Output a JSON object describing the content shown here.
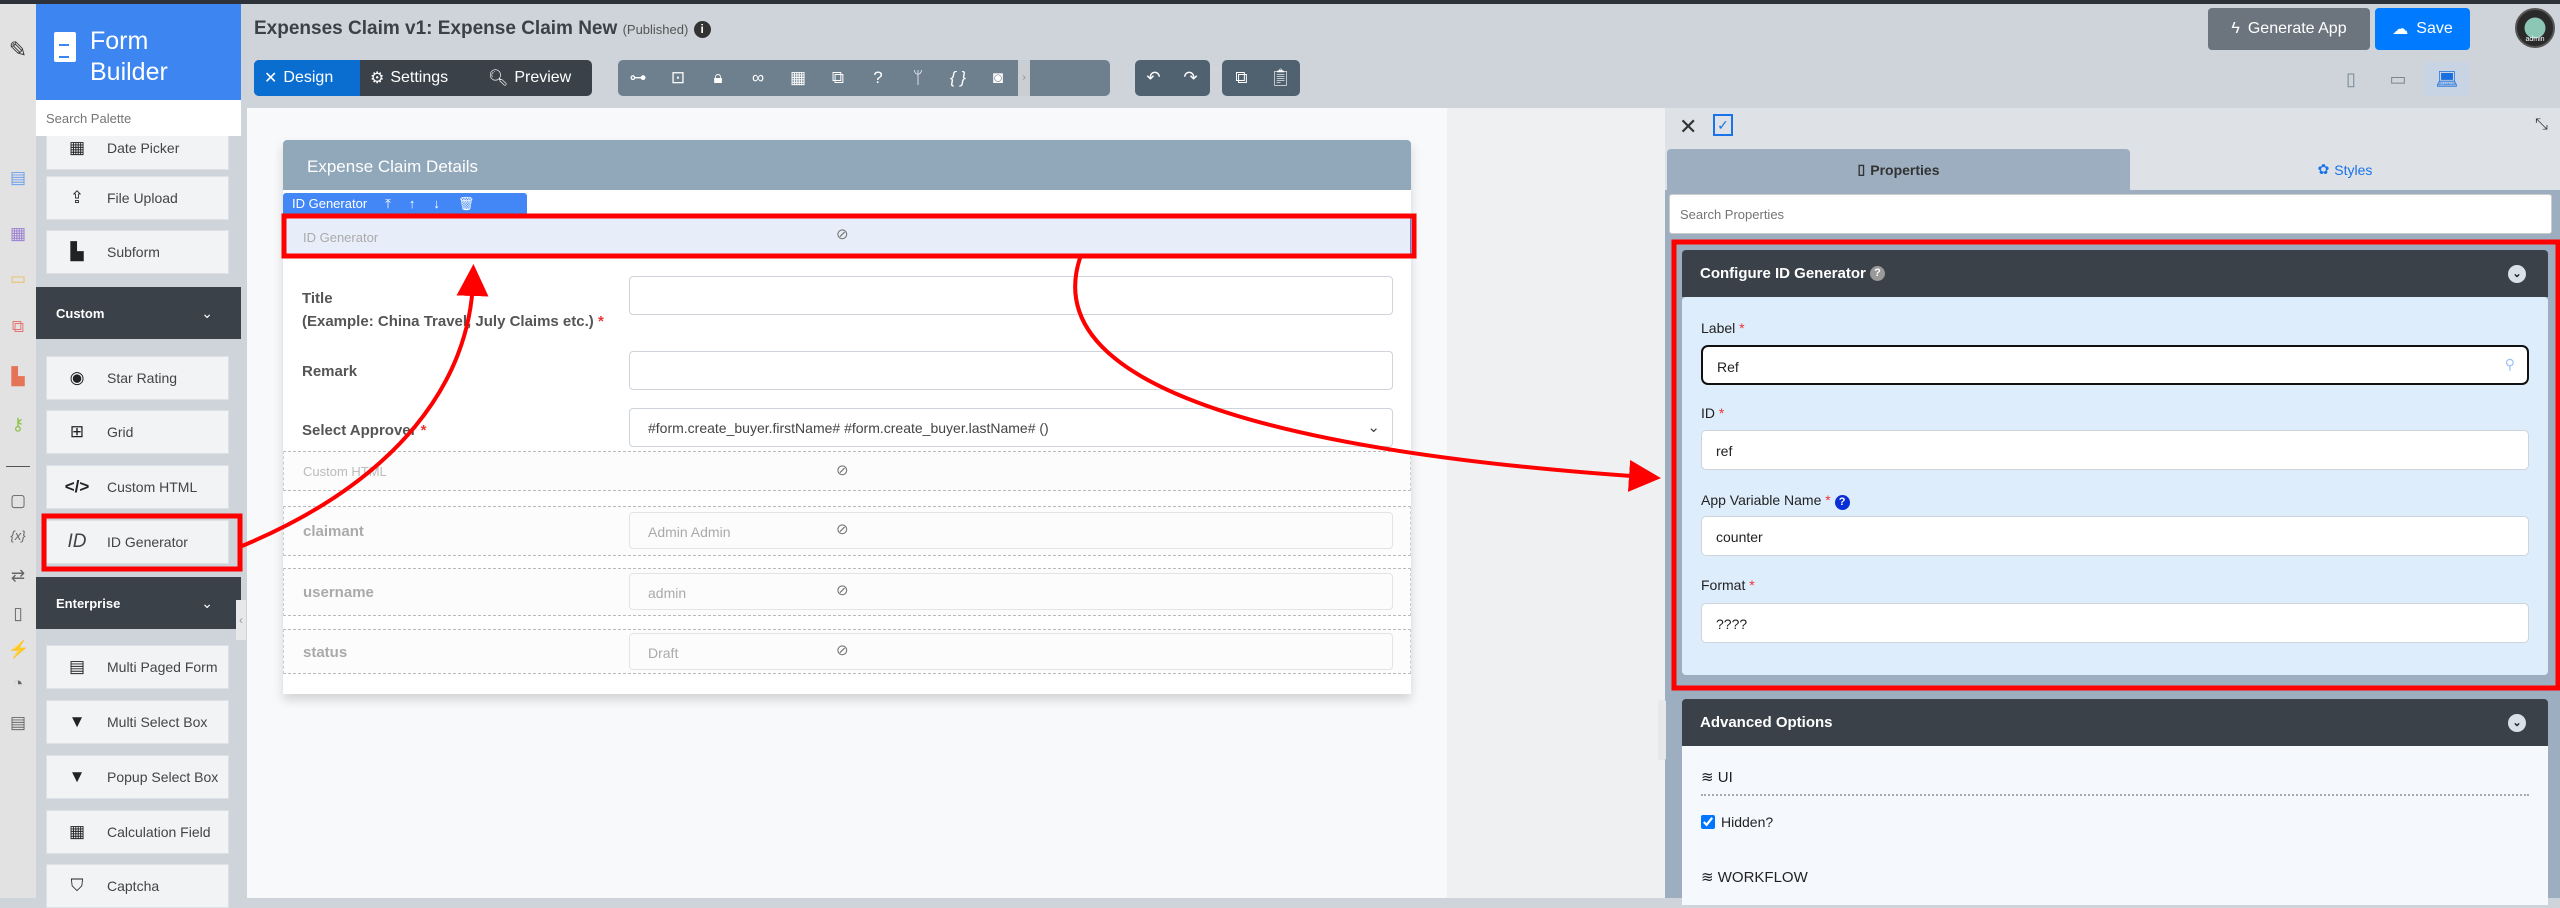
{
  "header": {
    "title": "Expenses Claim v1: Expense Claim New",
    "status": "(Published)",
    "generate_label": "Generate App",
    "save_label": "Save",
    "avatar_text": "admin"
  },
  "modes": [
    {
      "label": "Design",
      "icon": "design-icon"
    },
    {
      "label": "Settings",
      "icon": "gear-icon"
    },
    {
      "label": "Preview",
      "icon": "preview-icon"
    }
  ],
  "toolbar_icons": [
    "sitemap-icon",
    "import-icon",
    "lock-icon",
    "binoculars-icon",
    "table-icon",
    "translate-icon",
    "help-icon",
    "branch-icon",
    "braces-icon",
    "camera-icon"
  ],
  "palette": {
    "brand": "Form Builder",
    "search_placeholder": "Search Palette",
    "items_top": [
      "Date Picker",
      "File Upload",
      "Subform"
    ],
    "custom_label": "Custom",
    "custom_items": [
      "Star Rating",
      "Grid",
      "Custom HTML",
      "ID Generator"
    ],
    "enterprise_label": "Enterprise",
    "enterprise_items": [
      "Multi Paged Form",
      "Multi Select Box",
      "Popup Select Box",
      "Calculation Field",
      "Captcha"
    ]
  },
  "form": {
    "section_title": "Expense Claim Details",
    "selected_tab": "ID Generator",
    "id_generator_label": "ID Generator",
    "title_label": "Title",
    "title_hint": "(Example: China Travel, July Claims etc.)",
    "remark_label": "Remark",
    "approver_label": "Select Approver",
    "approver_value": "#form.create_buyer.firstName# #form.create_buyer.lastName# ()",
    "custom_html_label": "Custom HTML",
    "hidden_fields": [
      {
        "label": "claimant",
        "value": "Admin Admin"
      },
      {
        "label": "username",
        "value": "admin"
      },
      {
        "label": "status",
        "value": "Draft"
      }
    ]
  },
  "properties": {
    "tab_properties": "Properties",
    "tab_styles": "Styles",
    "search_placeholder": "Search Properties",
    "config_title": "Configure ID Generator",
    "fields": [
      {
        "label": "Label",
        "value": "Ref"
      },
      {
        "label": "ID",
        "value": "ref"
      },
      {
        "label": "App Variable Name",
        "value": "counter"
      },
      {
        "label": "Format",
        "value": "????"
      }
    ],
    "advanced_title": "Advanced Options",
    "ui_heading": "UI",
    "hidden_label": "Hidden?",
    "hidden_checked": true,
    "workflow_heading": "WORKFLOW"
  },
  "colors": {
    "accent": "#3d85f0",
    "highlight": "#ff0000",
    "dark": "#3a4149"
  }
}
